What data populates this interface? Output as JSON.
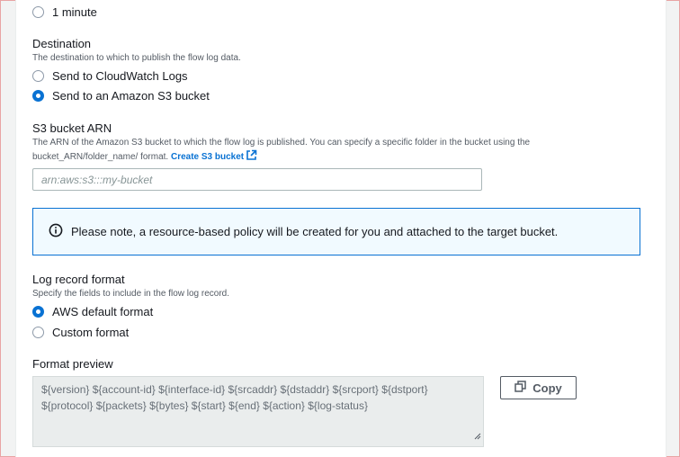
{
  "interval": {
    "option_1min": "1 minute"
  },
  "destination": {
    "label": "Destination",
    "description": "The destination to which to publish the flow log data.",
    "options": [
      "Send to CloudWatch Logs",
      "Send to an Amazon S3 bucket"
    ],
    "selected": "Send to an Amazon S3 bucket"
  },
  "s3_arn": {
    "label": "S3 bucket ARN",
    "description_line1": "The ARN of the Amazon S3 bucket to which the flow log is published. You can specify a specific folder in the bucket using the",
    "description_line2": "bucket_ARN/folder_name/ format.",
    "create_link": "Create S3 bucket",
    "link_icon": "external-link-icon",
    "placeholder": "arn:aws:s3:::my-bucket",
    "value": ""
  },
  "alert": {
    "icon": "info-icon",
    "text": "Please note, a resource-based policy will be created for you and attached to the target bucket."
  },
  "log_format": {
    "label": "Log record format",
    "description": "Specify the fields to include in the flow log record.",
    "options": [
      "AWS default format",
      "Custom format"
    ],
    "selected": "AWS default format"
  },
  "format_preview": {
    "label": "Format preview",
    "line1": "${version} ${account-id} ${interface-id} ${srcaddr} ${dstaddr} ${srcport} ${dstport}",
    "line2": "${protocol} ${packets} ${bytes} ${start} ${end} ${action} ${log-status}",
    "copy_label": "Copy",
    "copy_icon": "copy-icon"
  },
  "colors": {
    "accent": "#0972d3",
    "alert_bg": "#f1faff",
    "text": "#16191f",
    "muted": "#545b64"
  }
}
